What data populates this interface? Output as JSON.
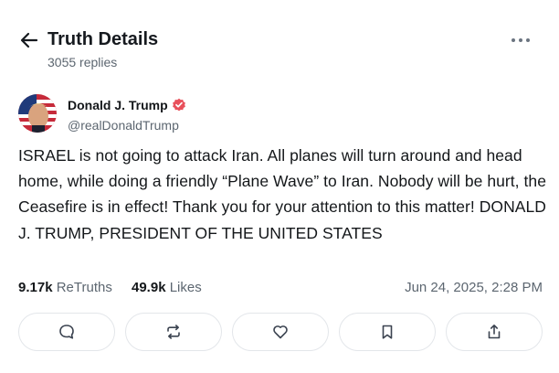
{
  "header": {
    "title": "Truth Details",
    "reply_count": "3055 replies",
    "back_icon": "arrow-left-icon",
    "more_icon": "ellipsis-icon"
  },
  "author": {
    "name": "Donald J. Trump",
    "handle": "@realDonaldTrump",
    "verified_icon": "verified-badge-icon",
    "verified_color": "#e8505b"
  },
  "post": {
    "text": "ISRAEL is not going to attack Iran. All planes will turn around and head home, while doing a friendly “Plane Wave” to Iran. Nobody will be hurt, the Ceasefire is in effect! Thank you for your attention to this matter! DONALD J. TRUMP, PRESIDENT OF THE UNITED STATES"
  },
  "stats": {
    "retruths_count": "9.17k",
    "retruths_label": "ReTruths",
    "likes_count": "49.9k",
    "likes_label": "Likes",
    "timestamp": "Jun 24, 2025, 2:28 PM"
  },
  "actions": [
    {
      "name": "reply",
      "icon": "reply-bubble-icon"
    },
    {
      "name": "retruth",
      "icon": "retruth-icon"
    },
    {
      "name": "like",
      "icon": "heart-icon"
    },
    {
      "name": "bookmark",
      "icon": "bookmark-icon"
    },
    {
      "name": "share",
      "icon": "share-icon"
    }
  ]
}
